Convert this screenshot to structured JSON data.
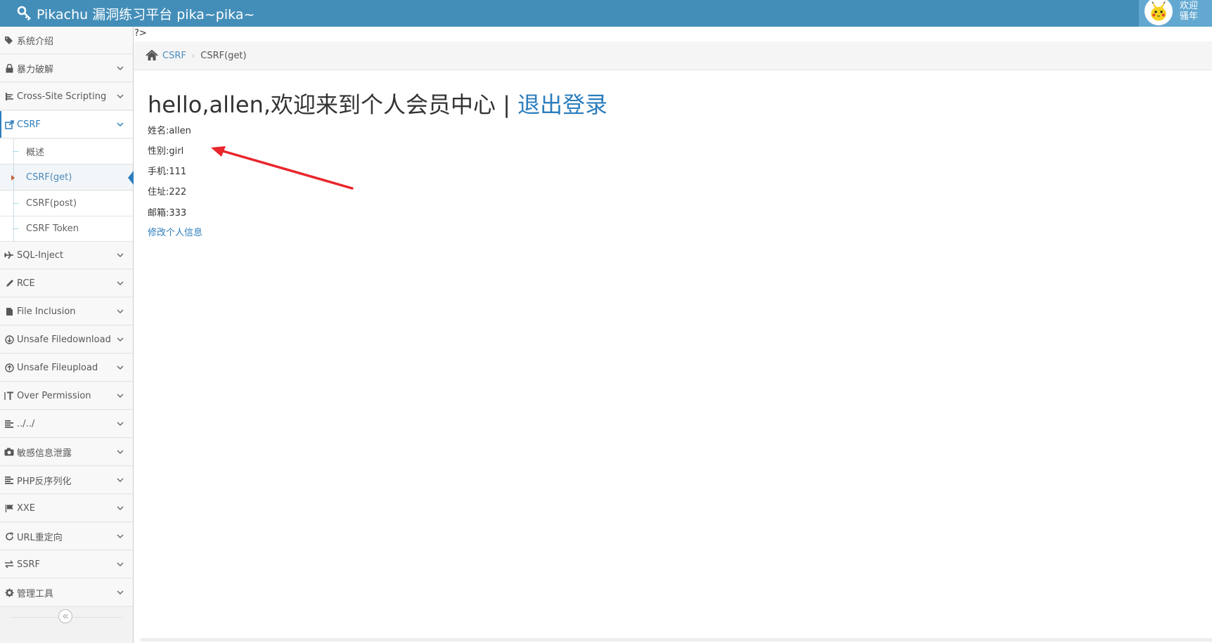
{
  "navbar": {
    "brand": "Pikachu 漏洞练习平台 pika~pika~",
    "user_line1": "欢迎",
    "user_line2": "骚年",
    "color": "#438eb9"
  },
  "sidebar": {
    "items": [
      {
        "label": "系统介绍",
        "icon": "tags-icon"
      },
      {
        "label": "暴力破解",
        "icon": "lock-icon"
      },
      {
        "label": "Cross-Site Scripting",
        "icon": "sitemap-icon"
      },
      {
        "label": "CSRF",
        "icon": "share-icon",
        "expanded": true
      },
      {
        "label": "SQL-Inject",
        "icon": "plane-icon"
      },
      {
        "label": "RCE",
        "icon": "pencil-icon"
      },
      {
        "label": "File Inclusion",
        "icon": "file-icon"
      },
      {
        "label": "Unsafe Filedownload",
        "icon": "download-icon"
      },
      {
        "label": "Unsafe Fileupload",
        "icon": "upload-icon"
      },
      {
        "label": "Over Permission",
        "icon": "text-height-icon"
      },
      {
        "label": "../../",
        "icon": "align-left-icon"
      },
      {
        "label": "敏感信息泄露",
        "icon": "camera-icon"
      },
      {
        "label": "PHP反序列化",
        "icon": "align-left-icon"
      },
      {
        "label": "XXE",
        "icon": "flag-icon"
      },
      {
        "label": "URL重定向",
        "icon": "refresh-icon"
      },
      {
        "label": "SSRF",
        "icon": "exchange-icon"
      },
      {
        "label": "管理工具",
        "icon": "gear-icon"
      }
    ],
    "csrf_submenu": [
      {
        "label": "概述"
      },
      {
        "label": "CSRF(get)",
        "active": true
      },
      {
        "label": "CSRF(post)"
      },
      {
        "label": "CSRF Token"
      }
    ]
  },
  "main": {
    "php_leftover": "?>",
    "breadcrumb": {
      "link": "CSRF",
      "current": "CSRF(get)"
    },
    "title_prefix": "hello,allen,欢迎来到个人会员中心 | ",
    "logout_label": "退出登录",
    "info": [
      "姓名:allen",
      "性别:girl",
      "手机:111",
      "住址:222",
      "邮箱:333"
    ],
    "edit_link": "修改个人信息",
    "accent": "#2b7dbc",
    "annotation_arrow_color": "#e8262c"
  }
}
